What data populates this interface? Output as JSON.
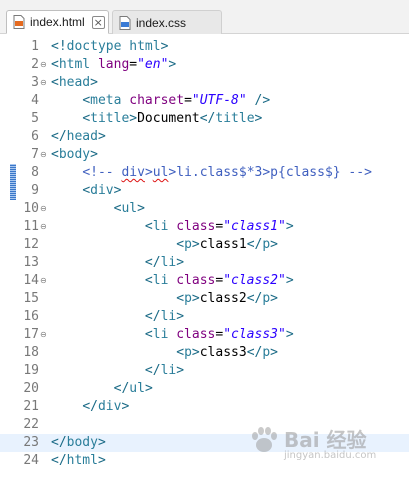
{
  "tabs": [
    {
      "label": "index.html",
      "active": true
    },
    {
      "label": "index.css",
      "active": false
    }
  ],
  "editor": {
    "current_line": 23,
    "changed_lines": [
      8,
      9
    ],
    "fold_lines": [
      2,
      3,
      7,
      10,
      11,
      14,
      17
    ],
    "lines": [
      [
        [
          "br",
          "<!"
        ],
        [
          "tag",
          "doctype html"
        ],
        [
          "br",
          ">"
        ]
      ],
      [
        [
          "br",
          "<"
        ],
        [
          "tag",
          "html "
        ],
        [
          "attr",
          "lang"
        ],
        [
          "txt",
          "="
        ],
        [
          "val",
          "\"en\""
        ],
        [
          "br",
          ">"
        ]
      ],
      [
        [
          "br",
          "<"
        ],
        [
          "tag",
          "head"
        ],
        [
          "br",
          ">"
        ]
      ],
      [
        [
          "txt",
          "    "
        ],
        [
          "br",
          "<"
        ],
        [
          "tag",
          "meta "
        ],
        [
          "attr",
          "charset"
        ],
        [
          "txt",
          "="
        ],
        [
          "val",
          "\"UTF-8\""
        ],
        [
          "txt",
          " "
        ],
        [
          "br",
          "/>"
        ]
      ],
      [
        [
          "txt",
          "    "
        ],
        [
          "br",
          "<"
        ],
        [
          "tag",
          "title"
        ],
        [
          "br",
          ">"
        ],
        [
          "txt",
          "Document"
        ],
        [
          "br",
          "</"
        ],
        [
          "tag",
          "title"
        ],
        [
          "br",
          ">"
        ]
      ],
      [
        [
          "br",
          "</"
        ],
        [
          "tag",
          "head"
        ],
        [
          "br",
          ">"
        ]
      ],
      [
        [
          "br",
          "<"
        ],
        [
          "tag",
          "body"
        ],
        [
          "br",
          ">"
        ]
      ],
      [
        [
          "txt",
          "    "
        ],
        [
          "cmt",
          "<!-- "
        ],
        [
          "cmtsq",
          "div"
        ],
        [
          "cmt",
          ">"
        ],
        [
          "cmtsq",
          "ul"
        ],
        [
          "cmt",
          ">li.class$*3>p{class$} -->"
        ]
      ],
      [
        [
          "txt",
          "    "
        ],
        [
          "br",
          "<"
        ],
        [
          "tag",
          "div"
        ],
        [
          "br",
          ">"
        ]
      ],
      [
        [
          "txt",
          "        "
        ],
        [
          "br",
          "<"
        ],
        [
          "tag",
          "ul"
        ],
        [
          "br",
          ">"
        ]
      ],
      [
        [
          "txt",
          "            "
        ],
        [
          "br",
          "<"
        ],
        [
          "tag",
          "li "
        ],
        [
          "attr",
          "class"
        ],
        [
          "txt",
          "="
        ],
        [
          "val",
          "\"class1\""
        ],
        [
          "br",
          ">"
        ]
      ],
      [
        [
          "txt",
          "                "
        ],
        [
          "br",
          "<"
        ],
        [
          "tag",
          "p"
        ],
        [
          "br",
          ">"
        ],
        [
          "txt",
          "class1"
        ],
        [
          "br",
          "</"
        ],
        [
          "tag",
          "p"
        ],
        [
          "br",
          ">"
        ]
      ],
      [
        [
          "txt",
          "            "
        ],
        [
          "br",
          "</"
        ],
        [
          "tag",
          "li"
        ],
        [
          "br",
          ">"
        ]
      ],
      [
        [
          "txt",
          "            "
        ],
        [
          "br",
          "<"
        ],
        [
          "tag",
          "li "
        ],
        [
          "attr",
          "class"
        ],
        [
          "txt",
          "="
        ],
        [
          "val",
          "\"class2\""
        ],
        [
          "br",
          ">"
        ]
      ],
      [
        [
          "txt",
          "                "
        ],
        [
          "br",
          "<"
        ],
        [
          "tag",
          "p"
        ],
        [
          "br",
          ">"
        ],
        [
          "txt",
          "class2"
        ],
        [
          "br",
          "</"
        ],
        [
          "tag",
          "p"
        ],
        [
          "br",
          ">"
        ]
      ],
      [
        [
          "txt",
          "            "
        ],
        [
          "br",
          "</"
        ],
        [
          "tag",
          "li"
        ],
        [
          "br",
          ">"
        ]
      ],
      [
        [
          "txt",
          "            "
        ],
        [
          "br",
          "<"
        ],
        [
          "tag",
          "li "
        ],
        [
          "attr",
          "class"
        ],
        [
          "txt",
          "="
        ],
        [
          "val",
          "\"class3\""
        ],
        [
          "br",
          ">"
        ]
      ],
      [
        [
          "txt",
          "                "
        ],
        [
          "br",
          "<"
        ],
        [
          "tag",
          "p"
        ],
        [
          "br",
          ">"
        ],
        [
          "txt",
          "class3"
        ],
        [
          "br",
          "</"
        ],
        [
          "tag",
          "p"
        ],
        [
          "br",
          ">"
        ]
      ],
      [
        [
          "txt",
          "            "
        ],
        [
          "br",
          "</"
        ],
        [
          "tag",
          "li"
        ],
        [
          "br",
          ">"
        ]
      ],
      [
        [
          "txt",
          "        "
        ],
        [
          "br",
          "</"
        ],
        [
          "tag",
          "ul"
        ],
        [
          "br",
          ">"
        ]
      ],
      [
        [
          "txt",
          "    "
        ],
        [
          "br",
          "</"
        ],
        [
          "tag",
          "div"
        ],
        [
          "br",
          ">"
        ]
      ],
      [],
      [
        [
          "br",
          "</"
        ],
        [
          "tag",
          "body"
        ],
        [
          "br",
          ">"
        ]
      ],
      [
        [
          "br",
          "</"
        ],
        [
          "tag",
          "html"
        ],
        [
          "br",
          ">"
        ]
      ]
    ]
  },
  "watermark": {
    "brand": "Bai 经验",
    "sub": "jingyan.baidu.com"
  },
  "colors": {
    "html_icon": "#e56a1f",
    "css_icon": "#3a7bd5"
  }
}
